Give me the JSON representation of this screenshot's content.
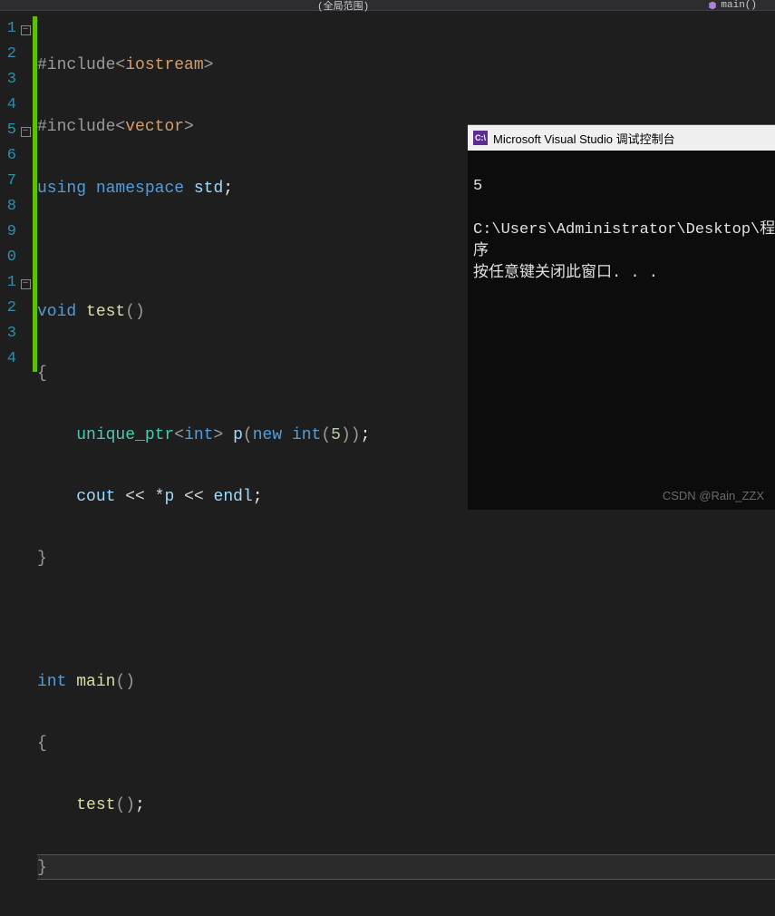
{
  "topbar": {
    "scope": "(全局范围)",
    "fn": "main()"
  },
  "gutter": [
    "1",
    "2",
    "3",
    "4",
    "5",
    "6",
    "7",
    "8",
    "9",
    "0",
    "1",
    "2",
    "3",
    "4"
  ],
  "fold": [
    "-",
    "",
    "",
    "",
    "-",
    "",
    "",
    "",
    "",
    "",
    "-",
    "",
    "",
    ""
  ],
  "changebar": [
    true,
    true,
    true,
    true,
    true,
    true,
    true,
    true,
    true,
    true,
    true,
    true,
    true,
    true
  ],
  "code": {
    "l1": {
      "hash": "#include",
      "lt": "<",
      "hdr": "iostream",
      "gt": ">"
    },
    "l2": {
      "hash": "#include",
      "lt": "<",
      "hdr": "vector",
      "gt": ">"
    },
    "l3": {
      "using": "using",
      "ns": "namespace",
      "std": "std",
      "semi": ";"
    },
    "l5": {
      "void": "void",
      "name": "test",
      "paren": "()"
    },
    "l6": {
      "brace": "{"
    },
    "l7": {
      "uptr": "unique_ptr",
      "lt": "<",
      "int": "int",
      "gt": ">",
      "p": "p",
      "lp": "(",
      "new": "new",
      "int2": "int",
      "lp2": "(",
      "five": "5",
      "rp2": ")",
      "rp": ")",
      "semi": ";"
    },
    "l8": {
      "cout": "cout",
      "ins1": "<<",
      "star": "*",
      "p": "p",
      "ins2": "<<",
      "endl": "endl",
      "semi": ";"
    },
    "l9": {
      "brace": "}"
    },
    "l11": {
      "int": "int",
      "name": "main",
      "paren": "()"
    },
    "l12": {
      "brace": "{"
    },
    "l13": {
      "call": "test",
      "paren": "()",
      "semi": ";"
    },
    "l14": {
      "brace": "}"
    }
  },
  "console": {
    "title": "Microsoft Visual Studio 调试控制台",
    "icon": "C:\\",
    "out1": "5",
    "out2": "C:\\Users\\Administrator\\Desktop\\程序",
    "out3": "按任意键关闭此窗口. . ."
  },
  "watermark": "CSDN @Rain_ZZX"
}
